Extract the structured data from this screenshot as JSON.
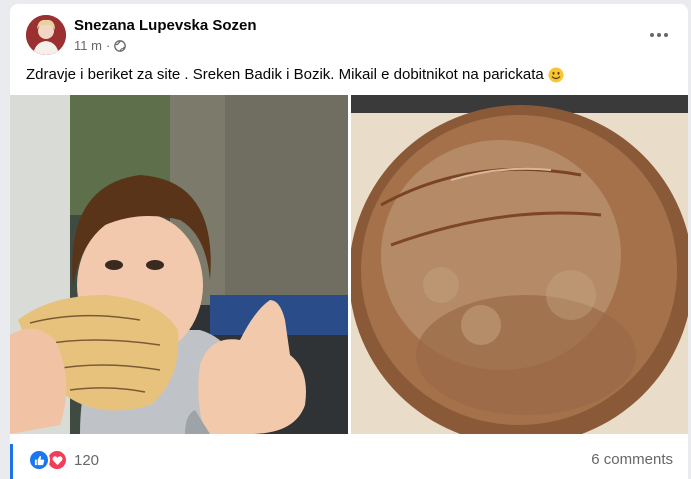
{
  "post": {
    "author": "Snezana Lupevska Sozen",
    "timestamp": "11 m",
    "privacy_icon": "globe-icon",
    "menu_icon": "more-horizontal-icon",
    "caption": "Zdravje i beriket za site . Sreken Badik i Bozik. Mikail e dobitnikot na parickata",
    "caption_emoji": "smiling-face-emoji"
  },
  "photos": [
    {
      "subject": "boy-eating-bread"
    },
    {
      "subject": "round-bread-loaf"
    }
  ],
  "footer": {
    "reaction_icons": [
      "like-icon",
      "love-icon"
    ],
    "reaction_count": "120",
    "comments_label": "6 comments"
  },
  "colors": {
    "like": "#1877f2",
    "love": "#f33e58",
    "secondary_text": "#65676b",
    "accent_bar": "#1b74e4"
  }
}
